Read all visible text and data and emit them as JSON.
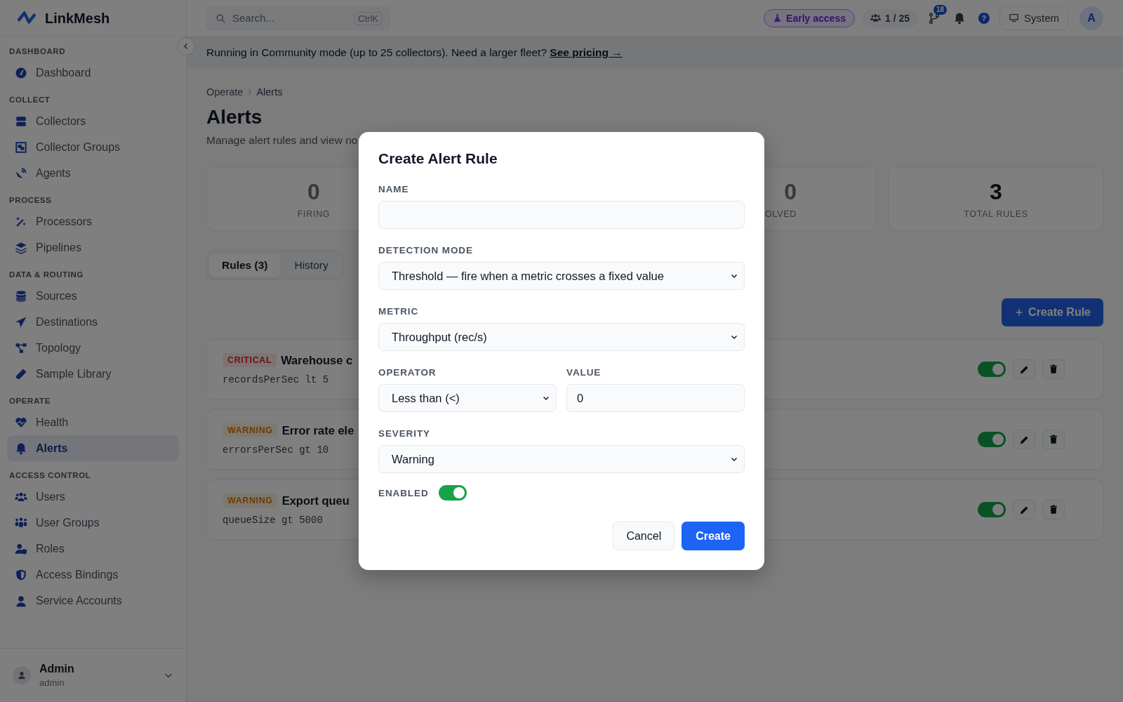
{
  "app": {
    "name": "LinkMesh"
  },
  "sidebar": {
    "sections": [
      {
        "title": "DASHBOARD",
        "items": [
          {
            "label": "Dashboard",
            "selected": false
          }
        ]
      },
      {
        "title": "COLLECT",
        "items": [
          {
            "label": "Collectors",
            "selected": false
          },
          {
            "label": "Collector Groups",
            "selected": false
          },
          {
            "label": "Agents",
            "selected": false
          }
        ]
      },
      {
        "title": "PROCESS",
        "items": [
          {
            "label": "Processors",
            "selected": false
          },
          {
            "label": "Pipelines",
            "selected": false
          }
        ]
      },
      {
        "title": "DATA & ROUTING",
        "items": [
          {
            "label": "Sources",
            "selected": false
          },
          {
            "label": "Destinations",
            "selected": false
          },
          {
            "label": "Topology",
            "selected": false
          },
          {
            "label": "Sample Library",
            "selected": false
          }
        ]
      },
      {
        "title": "OPERATE",
        "items": [
          {
            "label": "Health",
            "selected": false
          },
          {
            "label": "Alerts",
            "selected": true
          }
        ]
      },
      {
        "title": "ACCESS CONTROL",
        "items": [
          {
            "label": "Users",
            "selected": false
          },
          {
            "label": "User Groups",
            "selected": false
          },
          {
            "label": "Roles",
            "selected": false
          },
          {
            "label": "Access Bindings",
            "selected": false
          },
          {
            "label": "Service Accounts",
            "selected": false
          }
        ]
      }
    ],
    "user": {
      "name": "Admin",
      "login": "admin"
    }
  },
  "topbar": {
    "search": {
      "placeholder": "Search...",
      "shortcut": "CtrlK"
    },
    "early_access": "Early access",
    "seats": "1 / 25",
    "notifications_count": "18",
    "help": "?",
    "theme": "System",
    "avatar": "A"
  },
  "banner": {
    "text": "Running in Community mode (up to 25 collectors). Need a larger fleet?",
    "link": "See pricing →"
  },
  "breadcrumb": [
    "Operate",
    "Alerts"
  ],
  "page": {
    "title": "Alerts",
    "subtitle": "Manage alert rules and view no"
  },
  "stats": [
    {
      "value": "0",
      "label": "FIRING"
    },
    {
      "value": "0",
      "label": "OLVED"
    },
    {
      "value": "3",
      "label": "TOTAL RULES"
    }
  ],
  "tabs": [
    {
      "label": "Rules (3)",
      "selected": true
    },
    {
      "label": "History",
      "selected": false
    }
  ],
  "create_button": "Create Rule",
  "rules": [
    {
      "severity": "CRITICAL",
      "kind": "critical",
      "name": "Warehouse c",
      "condition": "recordsPerSec lt 5",
      "enabled": true
    },
    {
      "severity": "WARNING",
      "kind": "warning",
      "name": "Error rate ele",
      "condition": "errorsPerSec gt 10",
      "enabled": true
    },
    {
      "severity": "WARNING",
      "kind": "warning",
      "name": "Export queu",
      "condition": "queueSize gt 5000",
      "enabled": true
    }
  ],
  "modal": {
    "title": "Create Alert Rule",
    "rows": [
      [
        {
          "kind": "text",
          "label": "NAME"
        }
      ],
      [
        {
          "kind": "select",
          "label": "DETECTION MODE",
          "value": "Threshold — fire when a metric crosses a fixed value"
        }
      ],
      [
        {
          "kind": "select",
          "label": "METRIC",
          "value": "Throughput (rec/s)"
        }
      ],
      [
        {
          "kind": "select",
          "label": "OPERATOR",
          "value": "Less than (<)"
        },
        {
          "kind": "text",
          "label": "VALUE",
          "value": "0"
        }
      ],
      [
        {
          "kind": "select",
          "label": "SEVERITY",
          "value": "Warning"
        }
      ]
    ],
    "enabled": {
      "label": "ENABLED",
      "on": true
    },
    "buttons": [
      {
        "label": "Cancel",
        "kind": "secondary"
      },
      {
        "label": "Create",
        "kind": "primary"
      }
    ]
  }
}
